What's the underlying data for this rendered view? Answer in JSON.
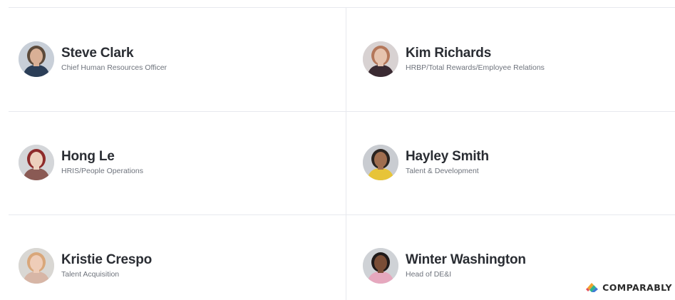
{
  "people": [
    {
      "name": "Steve Clark",
      "title": "Chief Human Resources Officer",
      "hair": "#5c4a3a",
      "skin": "#d9b096",
      "shirt": "#2b3e57",
      "bg": "#c8cfd8"
    },
    {
      "name": "Kim Richards",
      "title": "HRBP/Total Rewards/Employee Relations",
      "hair": "#b4775a",
      "skin": "#e6c3ae",
      "shirt": "#3a2a32",
      "bg": "#d8d2d2"
    },
    {
      "name": "Hong Le",
      "title": "HRIS/People Operations",
      "hair": "#8e2b2b",
      "skin": "#edd0bd",
      "shirt": "#8a5a54",
      "bg": "#d4d6d9"
    },
    {
      "name": "Hayley Smith",
      "title": "Talent & Development",
      "hair": "#2a2420",
      "skin": "#a06e4f",
      "shirt": "#e7c438",
      "bg": "#c9ccd1"
    },
    {
      "name": "Kristie Crespo",
      "title": "Talent Acquisition",
      "hair": "#d9a77a",
      "skin": "#efcdb8",
      "shirt": "#d7b6a6",
      "bg": "#d9d7d3"
    },
    {
      "name": "Winter Washington",
      "title": "Head of DE&I",
      "hair": "#1f1a1a",
      "skin": "#7a4d36",
      "shirt": "#e6a8be",
      "bg": "#cfd2d6"
    }
  ],
  "brand": {
    "logo_icon": "comparably-logo-icon",
    "name": "COMPARABLY"
  }
}
